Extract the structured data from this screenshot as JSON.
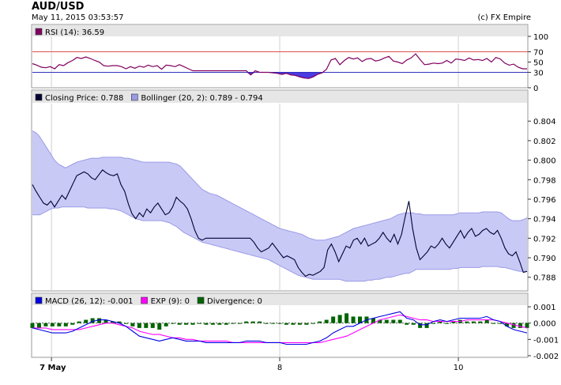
{
  "header": {
    "symbol": "AUD/USD",
    "datetime": "May 11, 2015 03:53:57",
    "copyright": "(c) FX Empire"
  },
  "colors": {
    "rsi": "#800060",
    "rsi_fill": "#4b3be0",
    "rsi_upper_line": "#e05050",
    "rsi_lower_line": "#3030c0",
    "price": "#000033",
    "band_fill": "#c9c9f6",
    "band_line": "#9a9ae6",
    "macd": "#0000e0",
    "exp": "#ff00ff",
    "div_pos": "#006400",
    "div_neg": "#006400",
    "legend_bg": "#e6e6e6",
    "grid": "#d0d0d0"
  },
  "chart_data": [
    {
      "type": "line",
      "panel": "rsi",
      "legend": [
        {
          "label": "RSI (14): 36.59"
        }
      ],
      "ylim": [
        0,
        100
      ],
      "yticks": [
        "100",
        "70",
        "50",
        "30",
        "0"
      ],
      "ytick_values": [
        100,
        70,
        50,
        30,
        0
      ],
      "reference_lines": [
        70,
        30
      ],
      "series": [
        {
          "values": [
            47,
            44,
            40,
            39,
            41,
            37,
            45,
            43,
            49,
            53,
            59,
            57,
            60,
            57,
            53,
            50,
            43,
            42,
            43,
            43,
            41,
            37,
            41,
            38,
            42,
            40,
            44,
            41,
            43,
            36,
            44,
            43,
            41,
            45,
            41,
            37,
            33,
            33,
            33,
            33,
            33,
            33,
            33,
            33,
            33,
            33,
            33,
            33,
            33,
            25,
            33,
            30,
            30,
            30,
            29,
            28,
            26,
            28,
            25,
            24,
            21,
            19,
            18,
            21,
            26,
            29,
            36,
            54,
            57,
            45,
            53,
            59,
            56,
            58,
            51,
            56,
            57,
            52,
            54,
            58,
            61,
            52,
            50,
            47,
            54,
            58,
            66,
            55,
            45,
            46,
            48,
            47,
            48,
            53,
            48,
            56,
            55,
            53,
            58,
            54,
            55,
            53,
            57,
            50,
            59,
            56,
            48,
            44,
            46,
            40,
            37,
            37
          ]
        }
      ]
    },
    {
      "type": "line",
      "panel": "price",
      "legend": [
        {
          "label": "Closing Price: 0.788"
        },
        {
          "label": "Bollinger (20, 2): 0.789 - 0.794"
        }
      ],
      "ylim": [
        0.7866,
        0.8058
      ],
      "yticks": [
        "0.804",
        "0.802",
        "0.800",
        "0.798",
        "0.796",
        "0.794",
        "0.792",
        "0.790",
        "0.788"
      ],
      "ytick_values": [
        0.804,
        0.802,
        0.8,
        0.798,
        0.796,
        0.794,
        0.792,
        0.79,
        0.788
      ],
      "series": [
        {
          "values": [
            0.7975,
            0.7968,
            0.7962,
            0.7956,
            0.7954,
            0.7958,
            0.7952,
            0.7958,
            0.7964,
            0.796,
            0.7968,
            0.7976,
            0.7984,
            0.7986,
            0.7988,
            0.7986,
            0.7982,
            0.798,
            0.7985,
            0.799,
            0.7987,
            0.7985,
            0.7984,
            0.7986,
            0.7975,
            0.7968,
            0.7955,
            0.7945,
            0.794,
            0.7946,
            0.7942,
            0.795,
            0.7946,
            0.7952,
            0.7956,
            0.795,
            0.7944,
            0.7946,
            0.7952,
            0.7962,
            0.7958,
            0.7955,
            0.795,
            0.794,
            0.7928,
            0.792,
            0.7918,
            0.792,
            0.792,
            0.792,
            0.792,
            0.792,
            0.792,
            0.792,
            0.792,
            0.792,
            0.792,
            0.792,
            0.792,
            0.792,
            0.7916,
            0.791,
            0.7906,
            0.7908,
            0.791,
            0.7915,
            0.791,
            0.7905,
            0.79,
            0.7902,
            0.79,
            0.7898,
            0.789,
            0.7885,
            0.7881,
            0.7883,
            0.7882,
            0.7884,
            0.7886,
            0.789,
            0.7908,
            0.7914,
            0.7906,
            0.7896,
            0.7904,
            0.7912,
            0.791,
            0.7918,
            0.792,
            0.7914,
            0.792,
            0.7912,
            0.7914,
            0.7916,
            0.792,
            0.7926,
            0.792,
            0.7916,
            0.7924,
            0.7914,
            0.7924,
            0.7942,
            0.7958,
            0.793,
            0.791,
            0.7898,
            0.7902,
            0.7906,
            0.7912,
            0.791,
            0.7914,
            0.792,
            0.7914,
            0.791,
            0.7916,
            0.7922,
            0.7928,
            0.792,
            0.7926,
            0.793,
            0.7922,
            0.7924,
            0.7928,
            0.793,
            0.7926,
            0.7924,
            0.7928,
            0.792,
            0.791,
            0.7904,
            0.7902,
            0.7906,
            0.7896,
            0.7885,
            0.7886
          ]
        },
        {
          "name": "bollinger-upper",
          "values": [
            0.803,
            0.8028,
            0.8024,
            0.8018,
            0.8012,
            0.8006,
            0.8,
            0.7996,
            0.7994,
            0.7992,
            0.7994,
            0.7996,
            0.7998,
            0.7999,
            0.8,
            0.8001,
            0.8002,
            0.8002,
            0.8002,
            0.8003,
            0.8003,
            0.8003,
            0.8003,
            0.8003,
            0.8003,
            0.8002,
            0.8002,
            0.8001,
            0.8,
            0.7999,
            0.7998,
            0.7998,
            0.7998,
            0.7998,
            0.7998,
            0.7998,
            0.7998,
            0.7998,
            0.7997,
            0.7996,
            0.7994,
            0.799,
            0.7986,
            0.7982,
            0.7978,
            0.7974,
            0.797,
            0.7968,
            0.7966,
            0.7965,
            0.7964,
            0.7962,
            0.796,
            0.7958,
            0.7956,
            0.7954,
            0.7952,
            0.795,
            0.7948,
            0.7946,
            0.7944,
            0.7942,
            0.794,
            0.7938,
            0.7936,
            0.7934,
            0.7932,
            0.793,
            0.7929,
            0.7928,
            0.7927,
            0.7926,
            0.7925,
            0.7924,
            0.7922,
            0.792,
            0.7919,
            0.7918,
            0.7918,
            0.7918,
            0.7919,
            0.792,
            0.7921,
            0.7922,
            0.7924,
            0.7926,
            0.7928,
            0.793,
            0.7931,
            0.7932,
            0.7933,
            0.7934,
            0.7935,
            0.7936,
            0.7937,
            0.7938,
            0.7939,
            0.794,
            0.7942,
            0.7944,
            0.7945,
            0.7946,
            0.7946,
            0.7946,
            0.7945,
            0.7945,
            0.7944,
            0.7944,
            0.7944,
            0.7944,
            0.7944,
            0.7944,
            0.7944,
            0.7944,
            0.7944,
            0.7945,
            0.7946,
            0.7946,
            0.7946,
            0.7946,
            0.7946,
            0.7946,
            0.7947,
            0.7947,
            0.7947,
            0.7947,
            0.7947,
            0.7946,
            0.7943,
            0.794,
            0.7938,
            0.7938,
            0.7938,
            0.7939,
            0.7941
          ]
        },
        {
          "name": "bollinger-lower",
          "values": [
            0.7944,
            0.7944,
            0.7944,
            0.7946,
            0.7948,
            0.795,
            0.7951,
            0.7951,
            0.7952,
            0.7952,
            0.7952,
            0.7952,
            0.7952,
            0.7952,
            0.7952,
            0.7951,
            0.7951,
            0.7951,
            0.7951,
            0.7951,
            0.7951,
            0.795,
            0.795,
            0.7949,
            0.7948,
            0.7946,
            0.7944,
            0.7942,
            0.794,
            0.7939,
            0.7938,
            0.7938,
            0.7938,
            0.7938,
            0.7938,
            0.7938,
            0.7937,
            0.7936,
            0.7934,
            0.7932,
            0.7929,
            0.7926,
            0.7924,
            0.7922,
            0.792,
            0.7918,
            0.7916,
            0.7915,
            0.7914,
            0.7913,
            0.7912,
            0.7911,
            0.791,
            0.7909,
            0.7908,
            0.7907,
            0.7906,
            0.7905,
            0.7904,
            0.7903,
            0.7902,
            0.7901,
            0.79,
            0.7899,
            0.7898,
            0.7896,
            0.7894,
            0.7892,
            0.789,
            0.7888,
            0.7886,
            0.7884,
            0.7882,
            0.7881,
            0.788,
            0.7879,
            0.7878,
            0.7878,
            0.7878,
            0.7878,
            0.7878,
            0.7878,
            0.7878,
            0.7878,
            0.7877,
            0.7876,
            0.7876,
            0.7876,
            0.7876,
            0.7876,
            0.7876,
            0.7877,
            0.7877,
            0.7878,
            0.7878,
            0.7879,
            0.788,
            0.788,
            0.7881,
            0.7882,
            0.7883,
            0.7884,
            0.7884,
            0.7886,
            0.7888,
            0.7888,
            0.7888,
            0.7888,
            0.7888,
            0.7888,
            0.7888,
            0.7888,
            0.7888,
            0.7888,
            0.7889,
            0.7889,
            0.789,
            0.789,
            0.789,
            0.789,
            0.789,
            0.789,
            0.7891,
            0.7891,
            0.7891,
            0.7891,
            0.7891,
            0.789,
            0.789,
            0.7889,
            0.7888,
            0.7887,
            0.7886,
            0.7886,
            0.7886
          ]
        }
      ]
    },
    {
      "type": "line",
      "panel": "macd",
      "legend": [
        {
          "label": "MACD (26, 12): -0.001"
        },
        {
          "label": "EXP (9): 0"
        },
        {
          "label": "Divergence: 0"
        }
      ],
      "ylim": [
        -0.0021,
        0.0011
      ],
      "yticks": [
        "0.001",
        "0.000",
        "-0.001",
        "-0.002"
      ],
      "ytick_values": [
        0.001,
        0.0,
        -0.001,
        -0.002
      ],
      "series": [
        {
          "name": "macd",
          "values": [
            -0.0003,
            -0.0004,
            -0.0005,
            -0.0006,
            -0.0006,
            -0.0006,
            -0.0005,
            -0.0003,
            -0.0001,
            0.0001,
            0.0002,
            0.0002,
            0.0001,
            0.0,
            -0.0002,
            -0.0005,
            -0.0008,
            -0.0009,
            -0.001,
            -0.0011,
            -0.001,
            -0.0009,
            -0.001,
            -0.0011,
            -0.0011,
            -0.0011,
            -0.0012,
            -0.0012,
            -0.0012,
            -0.0012,
            -0.0012,
            -0.0012,
            -0.0011,
            -0.0011,
            -0.0011,
            -0.0012,
            -0.0012,
            -0.0012,
            -0.0013,
            -0.0013,
            -0.0013,
            -0.0013,
            -0.0012,
            -0.0011,
            -0.0009,
            -0.0006,
            -0.0004,
            -0.0002,
            -0.0002,
            0.0,
            0.0002,
            0.0003,
            0.0004,
            0.0005,
            0.0006,
            0.0007,
            0.0003,
            0.0002,
            -0.0001,
            -0.0001,
            0.0001,
            0.0002,
            0.0001,
            0.0002,
            0.0003,
            0.0003,
            0.0003,
            0.0003,
            0.0004,
            0.0002,
            0.0001,
            -0.0002,
            -0.0004,
            -0.0005,
            -0.0006
          ]
        },
        {
          "name": "exp",
          "values": [
            -0.0003,
            -0.0003,
            -0.0003,
            -0.0004,
            -0.0004,
            -0.0004,
            -0.0004,
            -0.0004,
            -0.0003,
            -0.0002,
            -0.0001,
            0.0,
            0.0,
            -0.0001,
            -0.0002,
            -0.0003,
            -0.0005,
            -0.0006,
            -0.0007,
            -0.0007,
            -0.0008,
            -0.0009,
            -0.0009,
            -0.001,
            -0.001,
            -0.0011,
            -0.0011,
            -0.0011,
            -0.0011,
            -0.0011,
            -0.0012,
            -0.0012,
            -0.0012,
            -0.0012,
            -0.0012,
            -0.0012,
            -0.0012,
            -0.0012,
            -0.0012,
            -0.0012,
            -0.0012,
            -0.0012,
            -0.0012,
            -0.0012,
            -0.0011,
            -0.001,
            -0.0009,
            -0.0008,
            -0.0006,
            -0.0004,
            -0.0002,
            0.0,
            0.0002,
            0.0003,
            0.0004,
            0.0005,
            0.0004,
            0.0003,
            0.0002,
            0.0002,
            0.0001,
            0.0001,
            0.0001,
            0.0001,
            0.0001,
            0.0002,
            0.0002,
            0.0002,
            0.0002,
            0.0002,
            0.0001,
            0.0,
            -0.0001,
            -0.0002,
            -0.0003
          ]
        },
        {
          "name": "divergence",
          "values": [
            -0.0003,
            -0.0003,
            -0.0002,
            -0.0002,
            -0.0002,
            -0.0002,
            -0.0001,
            0.0001,
            0.0002,
            0.0003,
            0.0003,
            0.0002,
            0.0001,
            0.0001,
            0.0,
            -0.0002,
            -0.0003,
            -0.0003,
            -0.0003,
            -0.0004,
            -0.0002,
            0.0,
            -0.0001,
            -0.0001,
            -0.0001,
            0.0,
            -0.0001,
            -0.0001,
            -0.0001,
            -0.0001,
            0.0,
            0.0,
            0.0001,
            0.0001,
            0.0001,
            0.0,
            0.0,
            0.0,
            -0.0001,
            -0.0001,
            -0.0001,
            -0.0001,
            0.0,
            0.0001,
            0.0002,
            0.0004,
            0.0005,
            0.0006,
            0.0004,
            0.0004,
            0.0004,
            0.0003,
            0.0002,
            0.0002,
            0.0002,
            0.0002,
            -0.0001,
            -0.0001,
            -0.0003,
            -0.0003,
            0.0,
            0.0001,
            0.0,
            0.0001,
            0.0002,
            0.0001,
            0.0001,
            0.0001,
            0.0002,
            0.0,
            0.0,
            -0.0002,
            -0.0003,
            -0.0003,
            -0.0003
          ]
        }
      ]
    }
  ],
  "x_axis": {
    "ticks": [
      {
        "label": "7 May",
        "position": 0.04
      },
      {
        "label": "8",
        "position": 0.5
      },
      {
        "label": "10",
        "position": 0.86
      }
    ]
  }
}
